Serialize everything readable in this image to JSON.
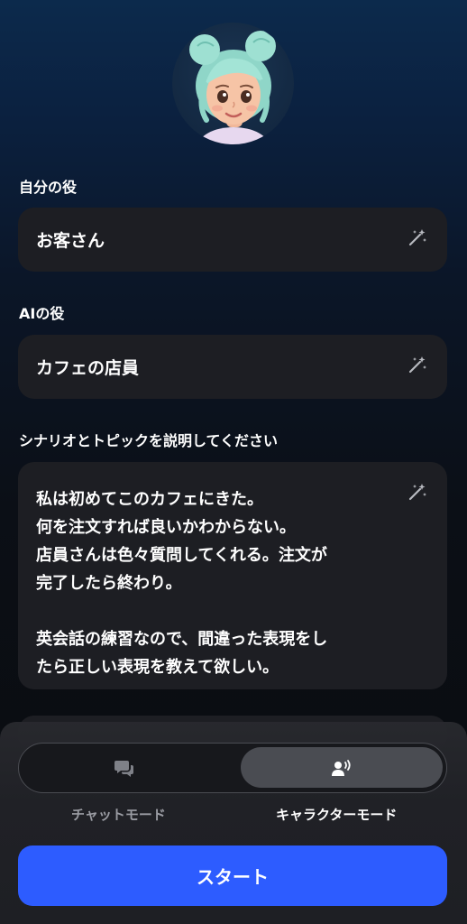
{
  "my_role": {
    "label": "自分の役",
    "value": "お客さん"
  },
  "ai_role": {
    "label": "AIの役",
    "value": "カフェの店員"
  },
  "scenario": {
    "label": "シナリオとトピックを説明してください",
    "text": "私は初めてこのカフェにきた。\n何を注文すれば良いかわからない。\n店員さんは色々質問してくれる。注文が\n完了したら終わり。\n\n英会話の練習なので、間違った表現をし\nたら正しい表現を教えて欲しい。"
  },
  "modes": {
    "chat_label": "チャットモード",
    "character_label": "キャラクターモード",
    "selected": "character"
  },
  "start_button": {
    "label": "スタート"
  },
  "colors": {
    "accent": "#2d5cff",
    "field_bg": "#1d1e23",
    "inactive_text": "#9a9ca3"
  },
  "icons": {
    "avatar": "cartoon-girl-avatar",
    "wand": "magic-wand-icon",
    "chat": "chat-bubbles-icon",
    "character": "person-voice-icon"
  }
}
